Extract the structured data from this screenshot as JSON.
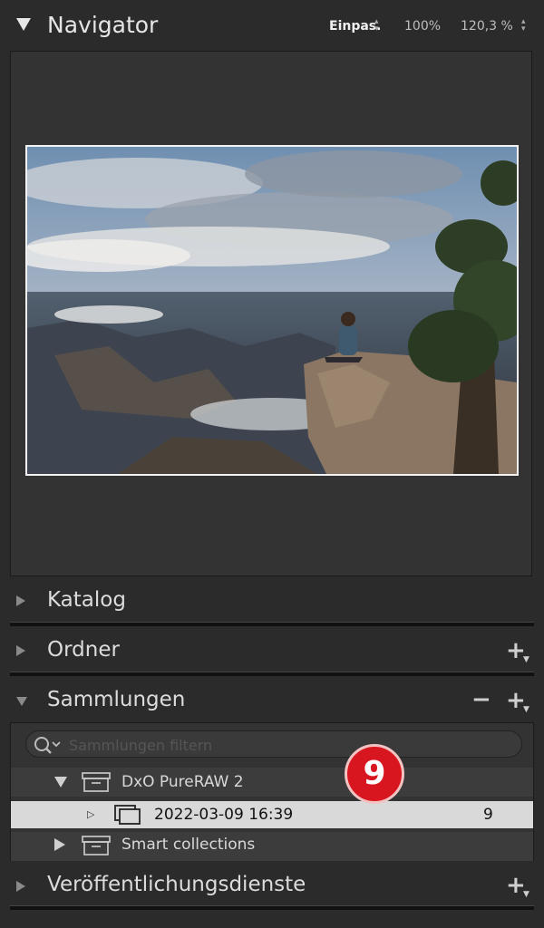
{
  "navigator": {
    "title": "Navigator",
    "fit_label": "Einpas.",
    "zoom_100": "100%",
    "zoom_custom": "120,3 %"
  },
  "sections": {
    "katalog": "Katalog",
    "ordner": "Ordner",
    "sammlungen": "Sammlungen",
    "veroeffentlichung": "Veröffentlichungsdienste"
  },
  "collections": {
    "search_placeholder": "Sammlungen filtern",
    "items": [
      {
        "label": "DxO PureRAW 2",
        "expanded": true
      },
      {
        "label": "2022-03-09 16:39",
        "count": "9",
        "selected": true
      },
      {
        "label": "Smart collections",
        "expanded": false
      }
    ]
  },
  "badge": "9",
  "icons": {
    "plus": "+",
    "minus": "−",
    "caret": "⌄",
    "updown": "▴▾"
  }
}
